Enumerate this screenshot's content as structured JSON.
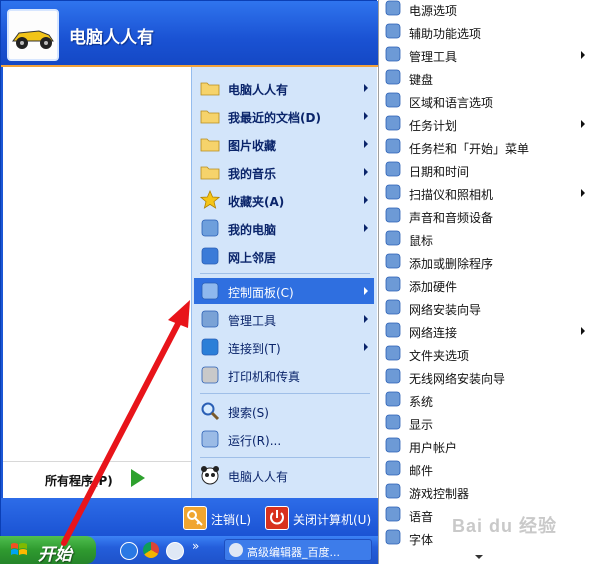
{
  "start_menu": {
    "user_name": "电脑人人有",
    "all_programs_label": "所有程序(P)",
    "right_items": [
      {
        "label": "电脑人人有",
        "bold": true,
        "arrow": true,
        "icon": "folder-icon"
      },
      {
        "label": "我最近的文档(D)",
        "bold": true,
        "arrow": true,
        "icon": "recent-documents-icon"
      },
      {
        "label": "图片收藏",
        "bold": true,
        "arrow": true,
        "icon": "pictures-folder-icon"
      },
      {
        "label": "我的音乐",
        "bold": true,
        "arrow": true,
        "icon": "music-folder-icon"
      },
      {
        "label": "收藏夹(A)",
        "bold": true,
        "arrow": true,
        "icon": "favorites-star-icon"
      },
      {
        "label": "我的电脑",
        "bold": true,
        "arrow": true,
        "icon": "my-computer-icon"
      },
      {
        "label": "网上邻居",
        "bold": true,
        "arrow": false,
        "icon": "network-places-icon"
      },
      {
        "label": "控制面板(C)",
        "bold": false,
        "arrow": true,
        "icon": "control-panel-icon",
        "highlighted": true
      },
      {
        "label": "管理工具",
        "bold": false,
        "arrow": true,
        "icon": "admin-tools-icon"
      },
      {
        "label": "连接到(T)",
        "bold": false,
        "arrow": true,
        "icon": "connect-to-icon"
      },
      {
        "label": "打印机和传真",
        "bold": false,
        "arrow": false,
        "icon": "printer-icon"
      },
      {
        "label": "搜索(S)",
        "bold": false,
        "arrow": false,
        "icon": "search-icon"
      },
      {
        "label": "运行(R)...",
        "bold": false,
        "arrow": false,
        "icon": "run-icon"
      },
      {
        "label": "电脑人人有",
        "bold": false,
        "arrow": false,
        "icon": "panda-icon"
      }
    ],
    "footer": {
      "logoff_label": "注销(L)",
      "shutdown_label": "关闭计算机(U)"
    }
  },
  "taskbar": {
    "start_label": "开始",
    "quicklaunch_icons": [
      "ie-icon",
      "chrome-icon",
      "sogou-icon"
    ],
    "overflow_label": "»",
    "task_label": "高级编辑器_百度..."
  },
  "submenu": {
    "items": [
      {
        "label": "电源选项",
        "arrow": false,
        "icon": "power-options-icon"
      },
      {
        "label": "辅助功能选项",
        "arrow": false,
        "icon": "accessibility-icon"
      },
      {
        "label": "管理工具",
        "arrow": true,
        "icon": "admin-tools-icon"
      },
      {
        "label": "键盘",
        "arrow": false,
        "icon": "keyboard-icon"
      },
      {
        "label": "区域和语言选项",
        "arrow": false,
        "icon": "globe-icon"
      },
      {
        "label": "任务计划",
        "arrow": true,
        "icon": "scheduled-tasks-icon"
      },
      {
        "label": "任务栏和「开始」菜单",
        "arrow": false,
        "icon": "taskbar-icon"
      },
      {
        "label": "日期和时间",
        "arrow": false,
        "icon": "clock-icon"
      },
      {
        "label": "扫描仪和照相机",
        "arrow": true,
        "icon": "scanner-icon"
      },
      {
        "label": "声音和音频设备",
        "arrow": false,
        "icon": "speaker-icon"
      },
      {
        "label": "鼠标",
        "arrow": false,
        "icon": "mouse-icon"
      },
      {
        "label": "添加或删除程序",
        "arrow": false,
        "icon": "add-remove-programs-icon"
      },
      {
        "label": "添加硬件",
        "arrow": false,
        "icon": "add-hardware-icon"
      },
      {
        "label": "网络安装向导",
        "arrow": false,
        "icon": "network-setup-icon"
      },
      {
        "label": "网络连接",
        "arrow": true,
        "icon": "network-connections-icon"
      },
      {
        "label": "文件夹选项",
        "arrow": false,
        "icon": "folder-options-icon"
      },
      {
        "label": "无线网络安装向导",
        "arrow": false,
        "icon": "wireless-icon"
      },
      {
        "label": "系统",
        "arrow": false,
        "icon": "system-icon"
      },
      {
        "label": "显示",
        "arrow": false,
        "icon": "display-icon"
      },
      {
        "label": "用户帐户",
        "arrow": false,
        "icon": "user-accounts-icon"
      },
      {
        "label": "邮件",
        "arrow": false,
        "icon": "mail-icon"
      },
      {
        "label": "游戏控制器",
        "arrow": false,
        "icon": "game-controller-icon"
      },
      {
        "label": "语音",
        "arrow": false,
        "icon": "speech-icon"
      },
      {
        "label": "字体",
        "arrow": false,
        "icon": "fonts-icon"
      }
    ]
  },
  "watermark": "Bai du 经验",
  "colors": {
    "menu_blue": "#1b57d6",
    "right_pane": "#d3e5fa",
    "highlight": "#2f6fe0",
    "start_green": "#2f9a2f",
    "annotation_red": "#e8141a"
  }
}
